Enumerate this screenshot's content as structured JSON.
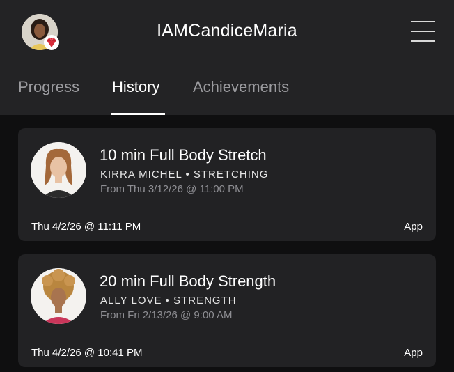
{
  "header": {
    "username": "IAMCandiceMaria",
    "avatar_icon": "profile-photo",
    "badge_icon": "red-gem-badge-icon",
    "menu_icon": "hamburger-menu-icon"
  },
  "tabs": [
    {
      "label": "Progress",
      "active": false
    },
    {
      "label": "History",
      "active": true
    },
    {
      "label": "Achievements",
      "active": false
    }
  ],
  "history": [
    {
      "title": "10 min Full Body Stretch",
      "meta": "KIRRA MICHEL • STRETCHING",
      "from": "From Thu 3/12/26 @ 11:00 PM",
      "date": "Thu 4/2/26 @ 11:11 PM",
      "source": "App"
    },
    {
      "title": "20 min Full Body Strength",
      "meta": "ALLY LOVE • STRENGTH",
      "from": "From Fri 2/13/26 @ 9:00 AM",
      "date": "Thu 4/2/26 @ 10:41 PM",
      "source": "App"
    }
  ],
  "colors": {
    "background": "#0f0f10",
    "header": "#232325",
    "card": "#222224",
    "muted_text": "#9b9b9f",
    "badge": "#d62b3a"
  }
}
